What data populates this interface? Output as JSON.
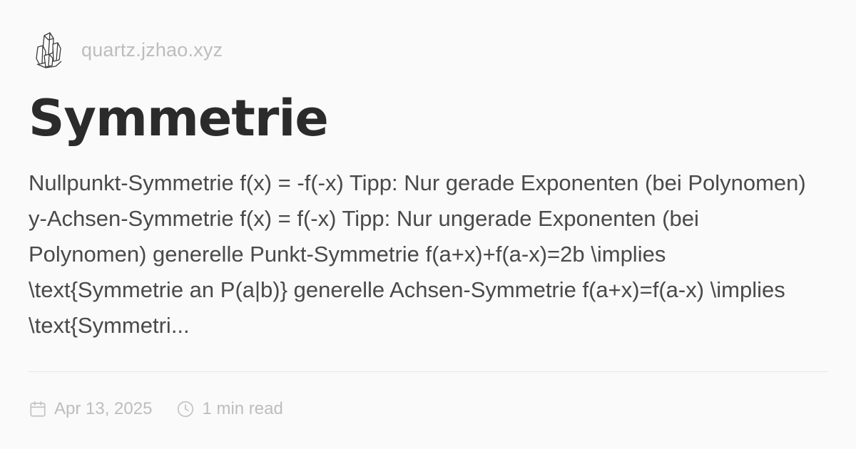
{
  "site": {
    "name": "quartz.jzhao.xyz",
    "logo_icon": "crystal-logo-icon"
  },
  "article": {
    "title": "Symmetrie",
    "excerpt": "Nullpunkt-Symmetrie f(x) = -f(-x) Tipp: Nur gerade Exponenten (bei Polynomen) y-Achsen-Symmetrie f(x) = f(-x) Tipp: Nur ungerade Exponenten (bei Polynomen) generelle Punkt-Symmetrie f(a+x)+f(a-x)=2b \\implies \\text{Symmetrie an P(a|b)} generelle Achsen-Symmetrie f(a+x)=f(a-x) \\implies \\text{Symmetri..."
  },
  "meta": {
    "date": "Apr 13, 2025",
    "date_icon": "calendar-icon",
    "reading_time": "1 min read",
    "reading_time_icon": "clock-icon"
  },
  "colors": {
    "background": "#fafafa",
    "title": "#2b2b2b",
    "text": "#4a4a4a",
    "muted": "#bdbdbd",
    "divider": "#e6e6e6"
  }
}
